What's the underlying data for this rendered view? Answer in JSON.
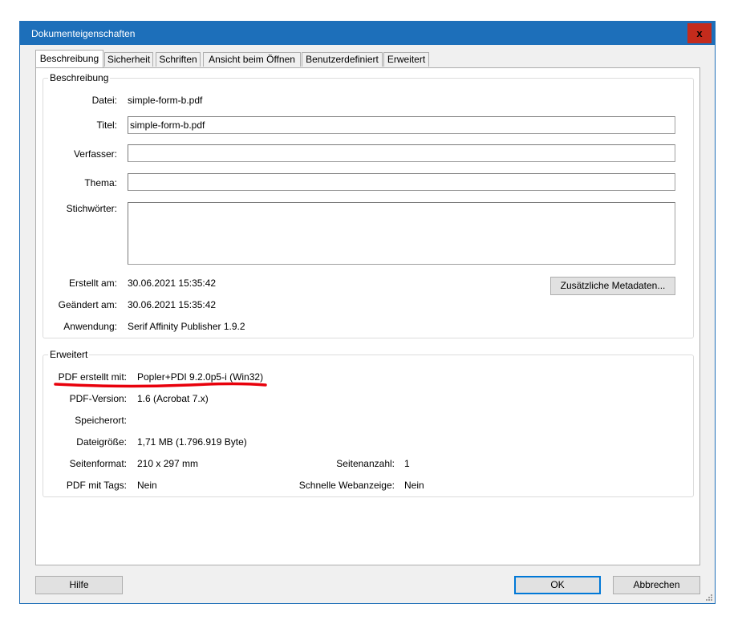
{
  "window": {
    "title": "Dokumenteigenschaften",
    "close_glyph": "x"
  },
  "tabs": [
    {
      "label": "Beschreibung"
    },
    {
      "label": "Sicherheit"
    },
    {
      "label": "Schriften"
    },
    {
      "label": "Ansicht beim Öffnen"
    },
    {
      "label": "Benutzerdefiniert"
    },
    {
      "label": "Erweitert"
    }
  ],
  "description": {
    "group_title": "Beschreibung",
    "datei_label": "Datei:",
    "datei_value": "simple-form-b.pdf",
    "titel_label": "Titel:",
    "titel_value": "simple-form-b.pdf",
    "verfasser_label": "Verfasser:",
    "verfasser_value": "",
    "thema_label": "Thema:",
    "thema_value": "",
    "stichwoerter_label": "Stichwörter:",
    "stichwoerter_value": "",
    "erstellt_label": "Erstellt am:",
    "erstellt_value": "30.06.2021 15:35:42",
    "geaendert_label": "Geändert am:",
    "geaendert_value": "30.06.2021 15:35:42",
    "anwendung_label": "Anwendung:",
    "anwendung_value": "Serif Affinity Publisher 1.9.2",
    "metadata_button": "Zusätzliche Metadaten..."
  },
  "advanced": {
    "group_title": "Erweitert",
    "producer_label": "PDF erstellt mit:",
    "producer_value": "Popler+PDI 9.2.0p5-i (Win32)",
    "version_label": "PDF-Version:",
    "version_value": "1.6 (Acrobat 7.x)",
    "location_label": "Speicherort:",
    "location_value": "",
    "size_label": "Dateigröße:",
    "size_value": "1,71 MB (1.796.919 Byte)",
    "format_label": "Seitenformat:",
    "format_value": "210 x 297 mm",
    "pages_label": "Seitenanzahl:",
    "pages_value": "1",
    "tags_label": "PDF mit Tags:",
    "tags_value": "Nein",
    "webview_label": "Schnelle Webanzeige:",
    "webview_value": "Nein",
    "annotation_color": "#e8000b"
  },
  "buttons": {
    "help": "Hilfe",
    "ok": "OK",
    "cancel": "Abbrechen"
  },
  "colors": {
    "titlebar": "#1d6fba",
    "close": "#c42b1c",
    "accent": "#0078d7"
  }
}
